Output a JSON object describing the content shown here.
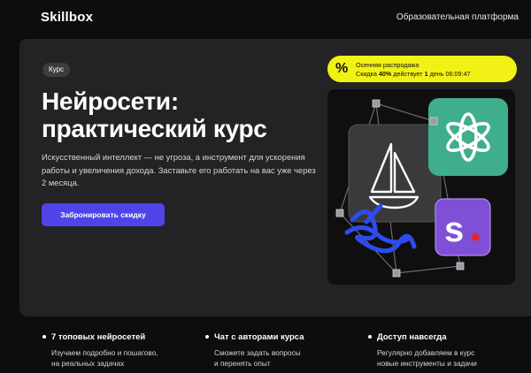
{
  "header": {
    "logo": "Skillbox",
    "tagline": "Образовательная платформа"
  },
  "hero": {
    "badge": "Курс",
    "title_line1": "Нейросети:",
    "title_line2": "практический курс",
    "description": "Искусственный интеллект — не угроза, а инструмент для ускорения работы и увеличения дохода. Заставьте его работать на вас уже через 2 месяца.",
    "cta_label": "Забронировать скидку"
  },
  "promo": {
    "icon": "%",
    "line1": "Осенняя распродажа",
    "prefix": "Скидка",
    "discount": "40%",
    "middle": "действует",
    "days_value": "1",
    "days_unit": "день",
    "timer": "06:09:47"
  },
  "art": {
    "icons": [
      "sailboat-icon",
      "openai-icon",
      "letter-s-icon",
      "cube-node-icon"
    ],
    "letter_s": "s",
    "colors": {
      "openai_bg": "#3fae8c",
      "s_bg": "#7f4fd6",
      "frame": "#3a3a3d",
      "accent_red": "#e3262f",
      "ribbon": "#2d4cf0"
    }
  },
  "features": [
    {
      "title": "7 топовых нейросетей",
      "line1": "Изучаем подробно и пошагово,",
      "line2": "на реальных задачах"
    },
    {
      "title": "Чат с авторами курса",
      "line1": "Сможете задать вопросы",
      "line2": "и перенять опыт"
    },
    {
      "title": "Доступ навсегда",
      "line1": "Регулярно добавляем в курс",
      "line2": "новые инструменты и задачи"
    }
  ],
  "colors": {
    "accent": "#4e44e8",
    "promo": "#f2f116",
    "background": "#0d0d0f",
    "card": "#232325"
  }
}
